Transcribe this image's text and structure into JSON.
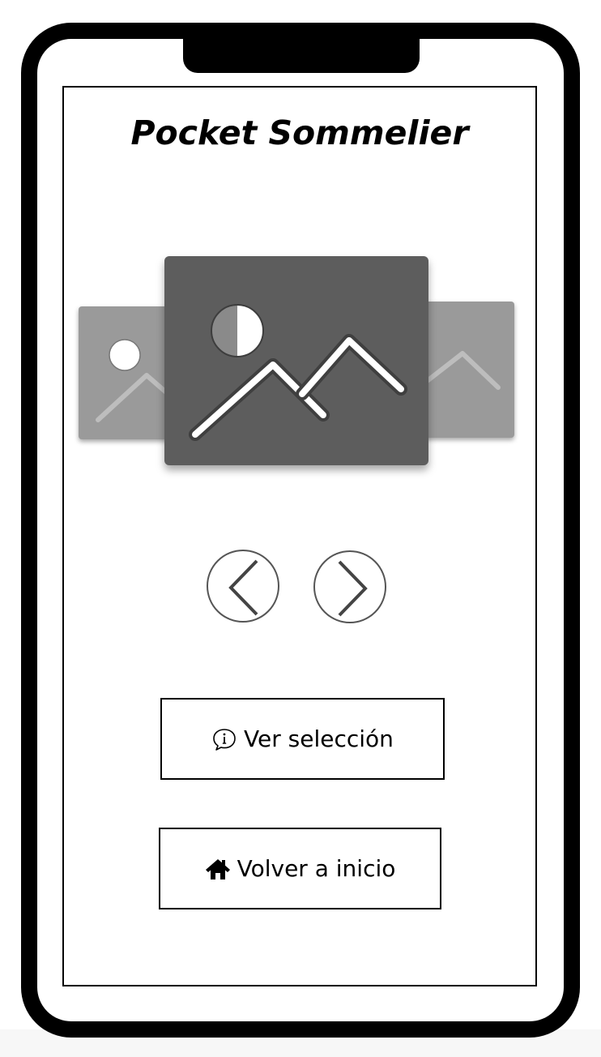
{
  "app": {
    "title": "Pocket Sommelier"
  },
  "carousel": {
    "images": [
      {
        "position": "left",
        "icon": "image-placeholder-icon"
      },
      {
        "position": "center",
        "icon": "image-placeholder-icon"
      },
      {
        "position": "right",
        "icon": "image-placeholder-icon"
      }
    ],
    "prev_icon": "chevron-left-icon",
    "next_icon": "chevron-right-icon"
  },
  "actions": {
    "view_selection": {
      "label": "Ver selección",
      "icon": "info-speech-bubble-icon"
    },
    "go_home": {
      "label": "Volver a inicio",
      "icon": "home-icon"
    }
  },
  "colors": {
    "frame": "#000000",
    "main_image": "#5d5d5d",
    "side_image": "#9a9a9a",
    "nav_button_border": "#555555"
  }
}
